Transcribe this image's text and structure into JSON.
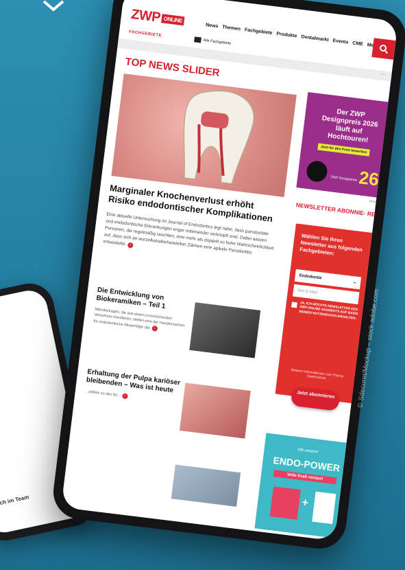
{
  "site": {
    "logo": "ZWP",
    "logo_badge": "ONLINE",
    "nav": [
      "News",
      "Themen",
      "Fachgebiete",
      "Produkte",
      "Dentalmarkt",
      "Events",
      "CME",
      "Mediacenter"
    ],
    "sub_label": "FACHGEBIETE",
    "all_label": "Alle Fachgebiete",
    "more_dots": "···"
  },
  "main": {
    "section_title": "TOP NEWS SLIDER",
    "headline": "Marginaler Knochenverlust erhöht Risiko endodontischer Komplikationen",
    "teaser": "Eine aktuelle Untersuchung im Journal of Endodontics legt nahe, dass parodontale und endodontische Erkrankungen enger miteinander verknüpft sind. Dabei wiesen Personen, die regelmäßig rauchten, eine mehr als doppelt so hohe Wahrscheinlichkeit auf, dass sich an wurzelkanalbehandelten Zähnen eine apikale Parodontitis entwickelte.",
    "articles": [
      {
        "title": "Die Entwicklung von Biokeramiken – Teil 1",
        "text": "Mikroleckagen, die aus einem unzureichenden Verschluss resultieren, stellen eine der Hauptursachen für endodontische Misserfolge dar."
      },
      {
        "title": "Erhaltung der Pulpa kariöser bleibenden – Was ist heute",
        "text": "…zählen zu den für…"
      }
    ]
  },
  "sidebar": {
    "ad_title": "Der ZWP Designpreis 2026 läuft auf Hochtouren!",
    "ad_badge": "Jetzt für den Preis bewerben",
    "ad_small": "ZWP Designpreis",
    "ad_number": "26",
    "ad_label": "Anzeige",
    "newsletter_title": "NEWSLETTER ABONNIE- REN",
    "newsletter_heading": "Wählen Sie Ihren Newsletter aus folgenden Fachgebieten:",
    "select_value": "Endodontie",
    "email_placeholder": "Ihre E-Mail",
    "legal": "Ja, ich möchte Newsletter des ZWP-online Angebots auf Basis meiner Nutzerdaten erhalten.",
    "info": "Weitere Informationen zum Thema Datenschutz",
    "subscribe": "Jetzt abonnieren",
    "ad2_sub": "Mit unserer",
    "ad2_title": "ENDO-POWER",
    "ad2_tag": "Volle Kraft voraus!"
  },
  "phone": {
    "lines": [
      "sich im Team"
    ]
  },
  "watermark": "© Sdecoret/Mockup – stock.adobe.com"
}
